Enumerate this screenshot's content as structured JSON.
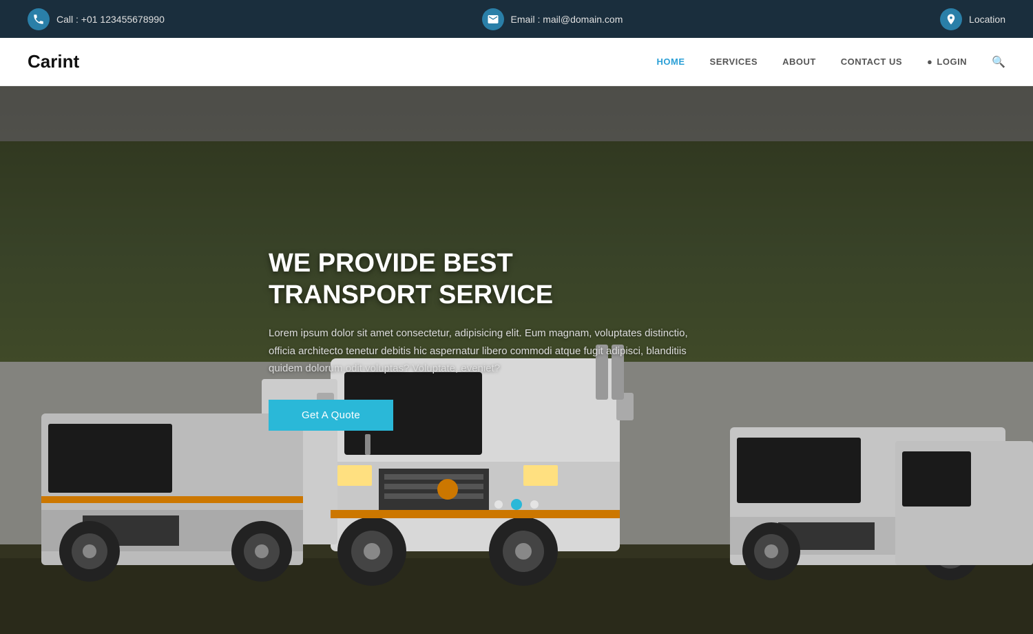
{
  "topbar": {
    "phone_icon": "phone-icon",
    "phone_label": "Call : +01 123455678990",
    "email_icon": "email-icon",
    "email_label": "Email : mail@domain.com",
    "location_icon": "location-icon",
    "location_label": "Location"
  },
  "navbar": {
    "brand": "Carint",
    "nav_items": [
      {
        "label": "HOME",
        "active": true
      },
      {
        "label": "SERVICES",
        "active": false
      },
      {
        "label": "ABOUT",
        "active": false
      },
      {
        "label": "CONTACT US",
        "active": false
      }
    ],
    "login_label": "LOGIN",
    "search_placeholder": "Search..."
  },
  "hero": {
    "title_line1": "WE PROVIDE BEST",
    "title_line2": "TRANSPORT SERVICE",
    "description": "Lorem ipsum dolor sit amet consectetur, adipisicing elit. Eum magnam, voluptates distinctio, officia architecto tenetur debitis hic aspernatur libero commodi atque fugit adipisci, blanditiis quidem dolorum odit voluptas? Voluptate, eveniet?",
    "cta_label": "Get A Quote",
    "slide_count": 3,
    "active_slide": 2
  },
  "colors": {
    "accent": "#2ab8d8",
    "dark_bg": "#1a2e3d",
    "white": "#ffffff",
    "nav_active": "#2a9fd6"
  }
}
